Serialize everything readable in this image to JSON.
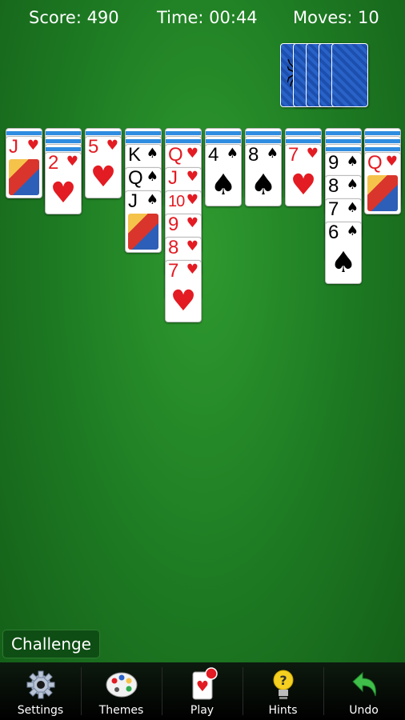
{
  "header": {
    "score": "Score: 490",
    "time": "Time: 00:44",
    "moves": "Moves: 10"
  },
  "stock": {
    "count": 5
  },
  "tableau": [
    {
      "down": 1,
      "up": [
        {
          "rank": "J",
          "suit": "♥",
          "color": "red",
          "face": true
        }
      ]
    },
    {
      "down": 3,
      "up": [
        {
          "rank": "2",
          "suit": "♥",
          "color": "red"
        }
      ]
    },
    {
      "down": 1,
      "up": [
        {
          "rank": "5",
          "suit": "♥",
          "color": "red"
        }
      ]
    },
    {
      "down": 2,
      "up": [
        {
          "rank": "K",
          "suit": "♠",
          "color": "black"
        },
        {
          "rank": "Q",
          "suit": "♠",
          "color": "black"
        },
        {
          "rank": "J",
          "suit": "♠",
          "color": "black",
          "face": true
        }
      ]
    },
    {
      "down": 2,
      "up": [
        {
          "rank": "Q",
          "suit": "♥",
          "color": "red"
        },
        {
          "rank": "J",
          "suit": "♥",
          "color": "red"
        },
        {
          "rank": "10",
          "suit": "♥",
          "color": "red"
        },
        {
          "rank": "9",
          "suit": "♥",
          "color": "red"
        },
        {
          "rank": "8",
          "suit": "♥",
          "color": "red"
        },
        {
          "rank": "7",
          "suit": "♥",
          "color": "red"
        }
      ]
    },
    {
      "down": 2,
      "up": [
        {
          "rank": "4",
          "suit": "♠",
          "color": "black"
        }
      ]
    },
    {
      "down": 2,
      "up": [
        {
          "rank": "8",
          "suit": "♠",
          "color": "black"
        }
      ]
    },
    {
      "down": 2,
      "up": [
        {
          "rank": "7",
          "suit": "♥",
          "color": "red"
        }
      ]
    },
    {
      "down": 3,
      "up": [
        {
          "rank": "9",
          "suit": "♠",
          "color": "black"
        },
        {
          "rank": "8",
          "suit": "♠",
          "color": "black"
        },
        {
          "rank": "7",
          "suit": "♠",
          "color": "black"
        },
        {
          "rank": "6",
          "suit": "♠",
          "color": "black"
        }
      ]
    },
    {
      "down": 3,
      "up": [
        {
          "rank": "Q",
          "suit": "♥",
          "color": "red",
          "face": true
        }
      ]
    }
  ],
  "challenge_label": "Challenge",
  "toolbar": [
    {
      "label": "Settings",
      "icon": "gear-icon"
    },
    {
      "label": "Themes",
      "icon": "palette-icon"
    },
    {
      "label": "Play",
      "icon": "cards-icon"
    },
    {
      "label": "Hints",
      "icon": "lightbulb-icon"
    },
    {
      "label": "Undo",
      "icon": "undo-arrow-icon"
    }
  ],
  "colors": {
    "table_green": "#1f7e24",
    "red_suit": "#e31b22",
    "card_back_blue": "#1c4fae"
  }
}
